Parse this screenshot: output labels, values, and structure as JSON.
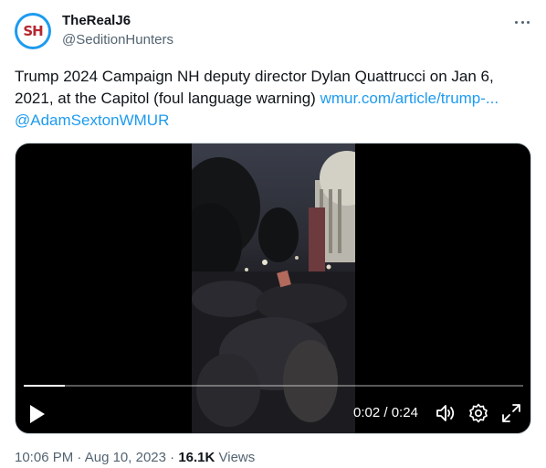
{
  "author": {
    "display_name": "TheRealJ6",
    "handle": "@SeditionHunters",
    "avatar_text": "SH"
  },
  "tweet": {
    "text": "Trump 2024 Campaign NH deputy director Dylan Quattrucci on Jan 6, 2021, at the Capitol (foul language warning) ",
    "link": "wmur.com/article/trump-...",
    "mention": "@AdamSextonWMUR"
  },
  "video": {
    "elapsed": "0:02",
    "separator": " / ",
    "duration": "0:24",
    "progress_fraction": 0.083,
    "icons": [
      "play-icon",
      "volume-icon",
      "settings-icon",
      "fullscreen-icon"
    ]
  },
  "meta": {
    "time": "10:06 PM",
    "dot1": " · ",
    "date": "Aug 10, 2023",
    "dot2": " · ",
    "views_count": "16.1K",
    "views_label": " Views"
  },
  "colors": {
    "accent": "#1d9bf0",
    "text": "#0f1419",
    "secondary": "#536471"
  }
}
